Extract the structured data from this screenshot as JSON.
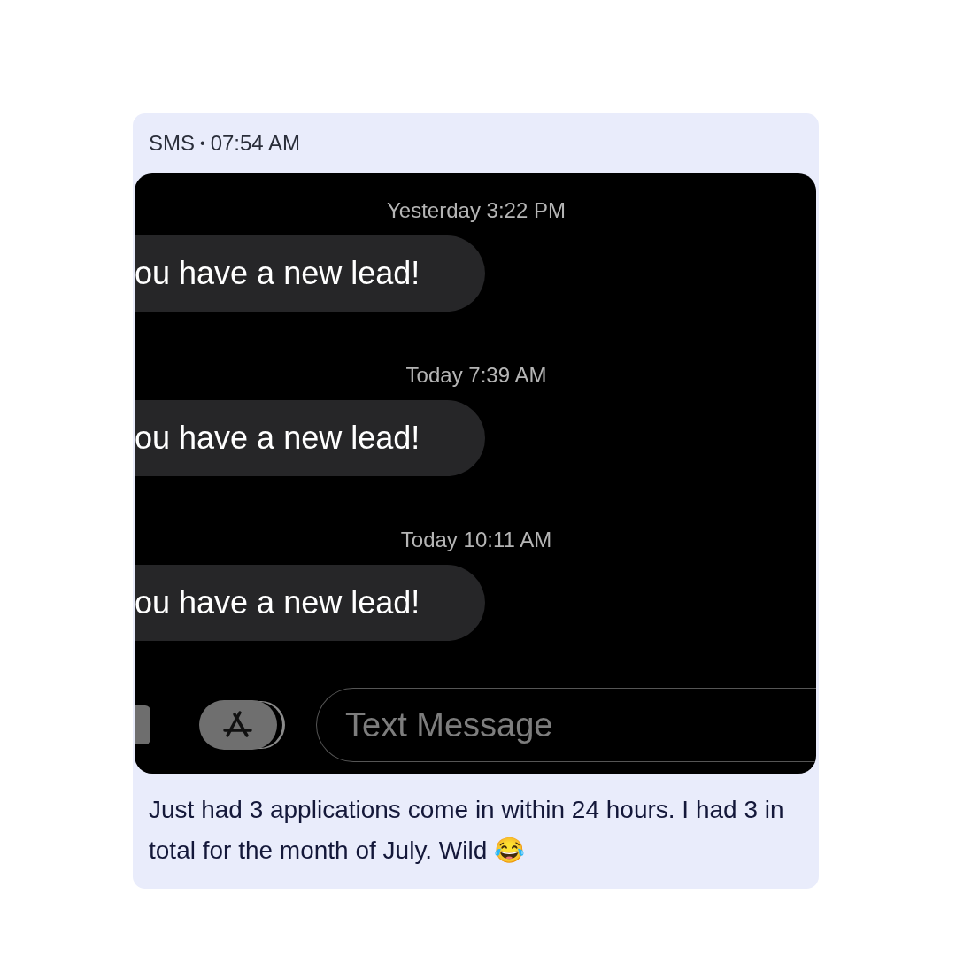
{
  "header": {
    "channel": "SMS",
    "separator": "•",
    "time": "07:54 AM"
  },
  "conversation": [
    {
      "timestamp": "Yesterday 3:22 PM",
      "message": "ou have a new lead!"
    },
    {
      "timestamp": "Today 7:39 AM",
      "message": "ou have a new lead!"
    },
    {
      "timestamp": "Today 10:11 AM",
      "message": "ou have a new lead!"
    }
  ],
  "composer": {
    "placeholder": "Text Message"
  },
  "caption": "Just had 3 applications come in within 24 hours. I had 3 in total for the month of July. Wild 😂"
}
